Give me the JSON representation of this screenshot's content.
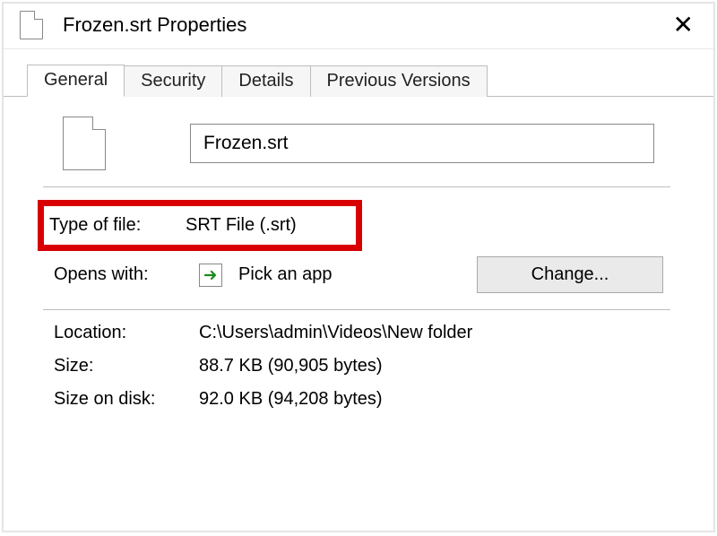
{
  "titlebar": {
    "title": "Frozen.srt Properties"
  },
  "tabs": {
    "general": "General",
    "security": "Security",
    "details": "Details",
    "previous": "Previous Versions"
  },
  "file": {
    "name": "Frozen.srt"
  },
  "props": {
    "type_label": "Type of file:",
    "type_value": "SRT File (.srt)",
    "opens_label": "Opens with:",
    "opens_value": "Pick an app",
    "change_btn": "Change...",
    "location_label": "Location:",
    "location_value": "C:\\Users\\admin\\Videos\\New folder",
    "size_label": "Size:",
    "size_value": "88.7 KB (90,905 bytes)",
    "diskSize_label": "Size on disk:",
    "diskSize_value": "92.0 KB (94,208 bytes)"
  }
}
